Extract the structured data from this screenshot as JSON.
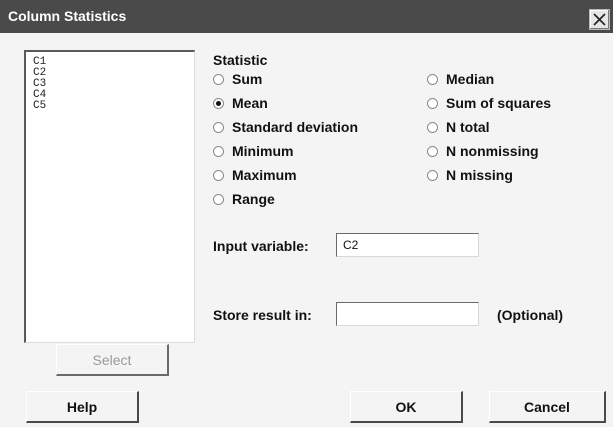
{
  "window": {
    "title": "Column Statistics",
    "close_label": "close"
  },
  "variable_list": [
    "C1",
    "C2",
    "C3",
    "C4",
    "C5"
  ],
  "statistic": {
    "group_label": "Statistic",
    "selected": "Mean",
    "options_left": [
      "Sum",
      "Mean",
      "Standard deviation",
      "Minimum",
      "Maximum",
      "Range"
    ],
    "options_right": [
      "Median",
      "Sum of squares",
      "N total",
      "N nonmissing",
      "N missing"
    ]
  },
  "input_variable": {
    "label": "Input variable:",
    "value": "C2"
  },
  "store_result": {
    "label": "Store result in:",
    "value": "",
    "optional_label": "(Optional)"
  },
  "buttons": {
    "select": "Select",
    "help": "Help",
    "ok": "OK",
    "cancel": "Cancel"
  }
}
